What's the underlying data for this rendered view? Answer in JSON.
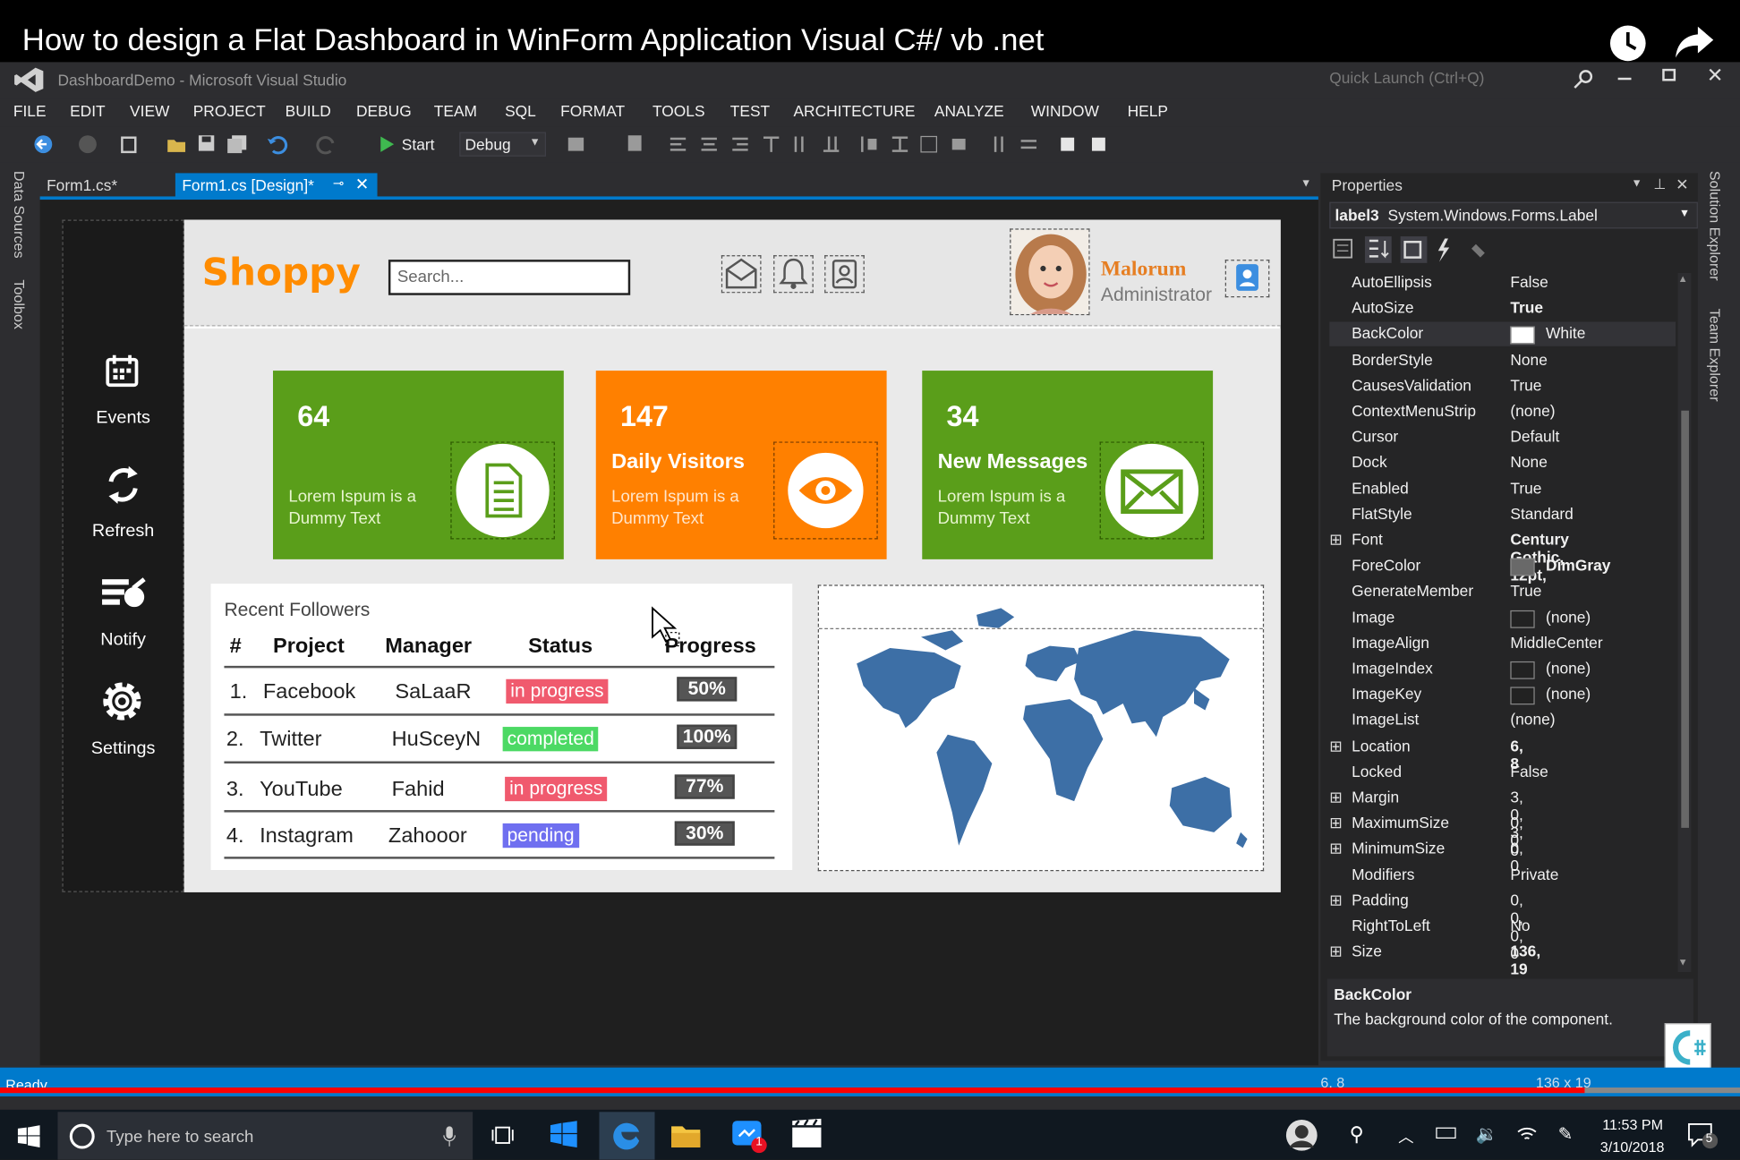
{
  "video": {
    "title": "How to design a Flat Dashboard in WinForm Application Visual C#/ vb .net"
  },
  "window": {
    "title": "DashboardDemo - Microsoft Visual Studio",
    "quick_launch": "Quick Launch (Ctrl+Q)"
  },
  "menu": [
    "FILE",
    "EDIT",
    "VIEW",
    "PROJECT",
    "BUILD",
    "DEBUG",
    "TEAM",
    "SQL",
    "FORMAT",
    "TOOLS",
    "TEST",
    "ARCHITECTURE",
    "ANALYZE",
    "WINDOW",
    "HELP"
  ],
  "toolbar": {
    "start": "Start",
    "config": "Debug"
  },
  "left_rails": [
    "Data Sources",
    "Toolbox"
  ],
  "right_rails": [
    "Solution Explorer",
    "Team Explorer"
  ],
  "tabs": [
    {
      "label": "Form1.cs*"
    },
    {
      "label": "Form1.cs [Design]*"
    }
  ],
  "form": {
    "brand": "Shoppy",
    "search_placeholder": "Search...",
    "user": {
      "name": "Malorum",
      "role": "Administrator"
    },
    "sidebar": [
      {
        "label": "Events"
      },
      {
        "label": "Refresh"
      },
      {
        "label": "Notify"
      },
      {
        "label": "Settings"
      }
    ],
    "cards": [
      {
        "number": "64",
        "label": "",
        "desc1": "Lorem Ispum is a",
        "desc2": "Dummy Text",
        "color": "#5a9e1a",
        "icon": "document-icon"
      },
      {
        "number": "147",
        "label": "Daily Visitors",
        "desc1": "Lorem Ispum is a",
        "desc2": "Dummy Text",
        "color": "#ff8000",
        "icon": "eye-icon"
      },
      {
        "number": "34",
        "label": "New Messages",
        "desc1": "Lorem Ispum is a",
        "desc2": "Dummy Text",
        "color": "#5a9e1a",
        "icon": "envelope-icon"
      }
    ],
    "followers": {
      "title": "Recent Followers",
      "headers": [
        "#",
        "Project",
        "Manager",
        "Status",
        "Progress"
      ],
      "rows": [
        {
          "n": "1.",
          "project": "Facebook",
          "manager": "SaLaaR",
          "status": "in progress",
          "status_color": "#f05a6e",
          "progress": "50%"
        },
        {
          "n": "2.",
          "project": "Twitter",
          "manager": "HuSceyN",
          "status": "completed",
          "status_color": "#4cd964",
          "progress": "100%"
        },
        {
          "n": "3.",
          "project": "YouTube",
          "manager": "Fahid",
          "status": "in progress",
          "status_color": "#f05a6e",
          "progress": "77%"
        },
        {
          "n": "4.",
          "project": "Instagram",
          "manager": "Zahooor",
          "status": "pending",
          "status_color": "#6f6ff0",
          "progress": "30%"
        }
      ]
    }
  },
  "properties": {
    "title": "Properties",
    "object": "label3",
    "object_type": "System.Windows.Forms.Label",
    "items": [
      {
        "name": "AutoEllipsis",
        "value": "False"
      },
      {
        "name": "AutoSize",
        "value": "True",
        "bold": true
      },
      {
        "name": "BackColor",
        "value": "White",
        "swatch": "#ffffff"
      },
      {
        "name": "BorderStyle",
        "value": "None"
      },
      {
        "name": "CausesValidation",
        "value": "True"
      },
      {
        "name": "ContextMenuStrip",
        "value": "(none)"
      },
      {
        "name": "Cursor",
        "value": "Default"
      },
      {
        "name": "Dock",
        "value": "None"
      },
      {
        "name": "Enabled",
        "value": "True"
      },
      {
        "name": "FlatStyle",
        "value": "Standard"
      },
      {
        "name": "Font",
        "value": "Century Gothic, 12pt,",
        "bold": true,
        "expand": true
      },
      {
        "name": "ForeColor",
        "value": "DimGray",
        "bold": true,
        "swatch": "#696969"
      },
      {
        "name": "GenerateMember",
        "value": "True"
      },
      {
        "name": "Image",
        "value": "(none)",
        "swatch": "#222222"
      },
      {
        "name": "ImageAlign",
        "value": "MiddleCenter"
      },
      {
        "name": "ImageIndex",
        "value": "(none)",
        "swatch": "#222222"
      },
      {
        "name": "ImageKey",
        "value": "(none)",
        "swatch": "#222222"
      },
      {
        "name": "ImageList",
        "value": "(none)"
      },
      {
        "name": "Location",
        "value": "6, 8",
        "bold": true,
        "expand": true
      },
      {
        "name": "Locked",
        "value": "False"
      },
      {
        "name": "Margin",
        "value": "3, 0, 3, 0",
        "expand": true
      },
      {
        "name": "MaximumSize",
        "value": "0, 0",
        "expand": true
      },
      {
        "name": "MinimumSize",
        "value": "0, 0",
        "expand": true
      },
      {
        "name": "Modifiers",
        "value": "Private"
      },
      {
        "name": "Padding",
        "value": "0, 0, 0, 0",
        "expand": true
      },
      {
        "name": "RightToLeft",
        "value": "No"
      },
      {
        "name": "Size",
        "value": "136, 19",
        "bold": true,
        "expand": true
      }
    ],
    "desc_title": "BackColor",
    "desc_text": "The background color of the component."
  },
  "status": {
    "text": "Ready",
    "pos": "6, 8",
    "size": "136 x 19"
  },
  "taskbar": {
    "search": "Type here to search",
    "time": "11:53 PM",
    "date": "3/10/2018",
    "badge": "1",
    "notif": "5"
  }
}
